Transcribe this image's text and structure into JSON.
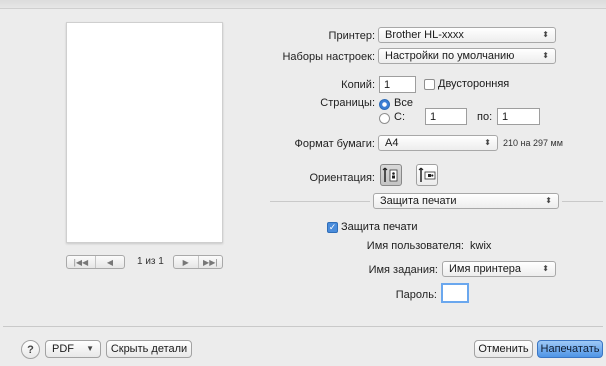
{
  "preview": {
    "page_count": "1 из 1",
    "nav": {
      "first": "|◀◀",
      "prev": "◀",
      "next": "▶",
      "last": "▶▶|"
    }
  },
  "printer": {
    "label": "Принтер:",
    "value": "Brother HL-xxxx"
  },
  "presets": {
    "label": "Наборы настроек:",
    "value": "Настройки по умолчанию"
  },
  "copies": {
    "label": "Копий:",
    "value": "1",
    "duplex_label": "Двусторонняя",
    "duplex_checked": false
  },
  "pages": {
    "label": "Страницы:",
    "all_label": "Все",
    "from_label": "С:",
    "from_value": "1",
    "to_label": "по:",
    "to_value": "1",
    "selected": "all"
  },
  "paper": {
    "label": "Формат бумаги:",
    "value": "A4",
    "size_text": "210 на 297 мм"
  },
  "orientation": {
    "label": "Ориентация:",
    "selected": "portrait"
  },
  "section": {
    "value": "Защита печати"
  },
  "secure": {
    "checkbox_label": "Защита печати",
    "checked": true,
    "username_label": "Имя пользователя:",
    "username_value": "kwix",
    "job_label": "Имя задания:",
    "job_value": "Имя принтера",
    "password_label": "Пароль:",
    "password_value": ""
  },
  "footer": {
    "help": "?",
    "pdf": "PDF",
    "hide_details": "Скрыть детали",
    "cancel": "Отменить",
    "print": "Напечатать"
  },
  "colors": {
    "accent": "#4f95e6",
    "background": "#ececec"
  }
}
